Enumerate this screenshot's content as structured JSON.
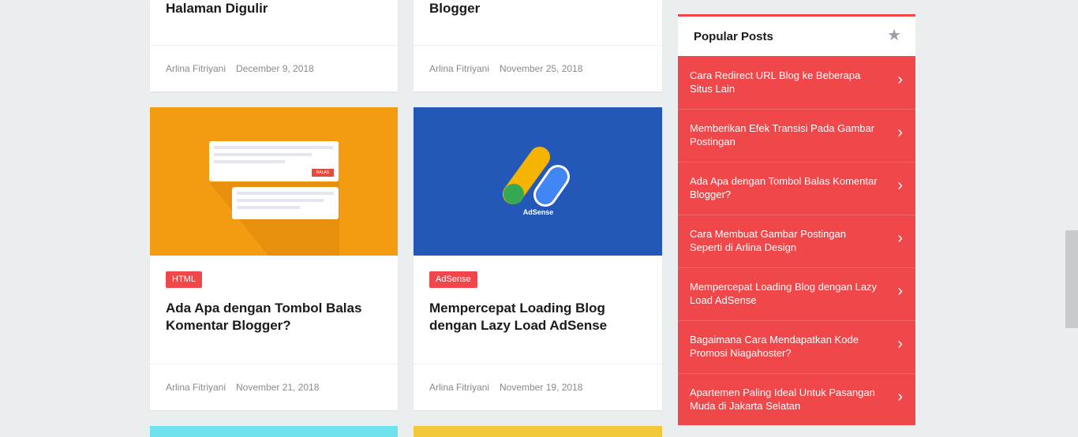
{
  "cards": [
    {
      "title": "Halaman Digulir",
      "author": "Arlina Fitriyani",
      "date": "December 9, 2018"
    },
    {
      "title": "Blogger",
      "author": "Arlina Fitriyani",
      "date": "November 25, 2018"
    },
    {
      "label": "HTML",
      "title": "Ada Apa dengan Tombol Balas Komentar Blogger?",
      "author": "Arlina Fitriyani",
      "date": "November 21, 2018",
      "thumb_button": "BALAS"
    },
    {
      "label": "AdSense",
      "title": "Mempercepat Loading Blog dengan Lazy Load AdSense",
      "author": "Arlina Fitriyani",
      "date": "November 19, 2018",
      "thumb_logo": "AdSense"
    }
  ],
  "sidebar": {
    "title": "Popular Posts",
    "icon": "star-icon",
    "items": [
      {
        "label": "Cara Redirect URL Blog ke Beberapa Situs Lain"
      },
      {
        "label": "Memberikan Efek Transisi Pada Gambar Postingan"
      },
      {
        "label": "Ada Apa dengan Tombol Balas Komentar Blogger?"
      },
      {
        "label": "Cara Membuat Gambar Postingan Seperti di Arlina Design"
      },
      {
        "label": "Mempercepat Loading Blog dengan Lazy Load AdSense"
      },
      {
        "label": "Bagaimana Cara Mendapatkan Kode Promosi Niagahoster?"
      },
      {
        "label": "Apartemen Paling Ideal Untuk Pasangan Muda di Jakarta Selatan"
      }
    ]
  },
  "colors": {
    "accent": "#f0474a",
    "background": "#ebeeef",
    "thumb_orange": "#f39c12",
    "thumb_blue": "#2458b8"
  }
}
